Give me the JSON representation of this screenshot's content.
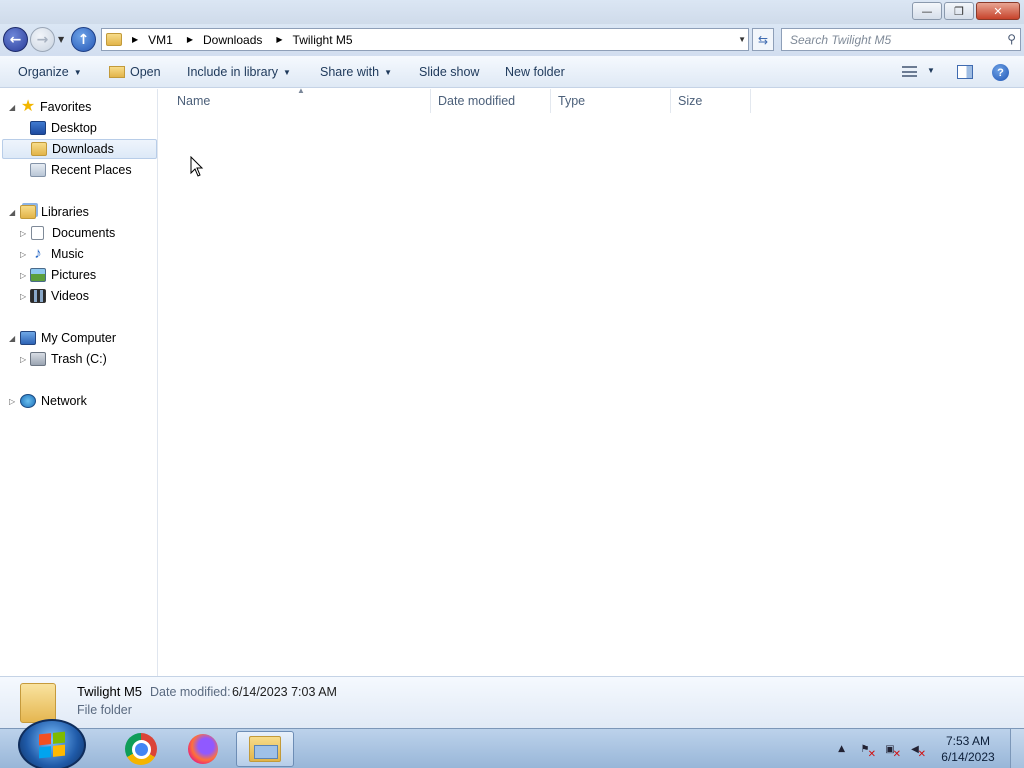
{
  "window": {
    "minimize_glyph": "—",
    "restore_glyph": "❐",
    "close_glyph": "✕"
  },
  "address": {
    "breadcrumbs": [
      "VM1",
      "Downloads",
      "Twilight M5"
    ],
    "search_placeholder": "Search Twilight M5"
  },
  "toolbar": {
    "organize": "Organize",
    "open": "Open",
    "include_in_library": "Include in library",
    "share_with": "Share with",
    "slide_show": "Slide show",
    "new_folder": "New folder"
  },
  "nav": {
    "favorites": "Favorites",
    "desktop": "Desktop",
    "downloads": "Downloads",
    "recent_places": "Recent Places",
    "libraries": "Libraries",
    "documents": "Documents",
    "music": "Music",
    "pictures": "Pictures",
    "videos": "Videos",
    "my_computer": "My Computer",
    "trash_c": "Trash (C:)",
    "network": "Network"
  },
  "columns": {
    "name": "Name",
    "date_modified": "Date modified",
    "type": "Type",
    "size": "Size"
  },
  "details": {
    "name": "Twilight M5",
    "date_modified_label": "Date modified:",
    "date_modified_value": "6/14/2023 7:03 AM",
    "type": "File folder"
  },
  "taskbar": {
    "apps": [
      "chrome-icon",
      "firefox-icon",
      "windows-explorer-icon"
    ],
    "time": "7:53 AM",
    "date": "6/14/2023"
  },
  "colors": {
    "accent": "#1e395b",
    "selected_bg": "#dde9f7",
    "taskbar": "#98b6d8"
  }
}
